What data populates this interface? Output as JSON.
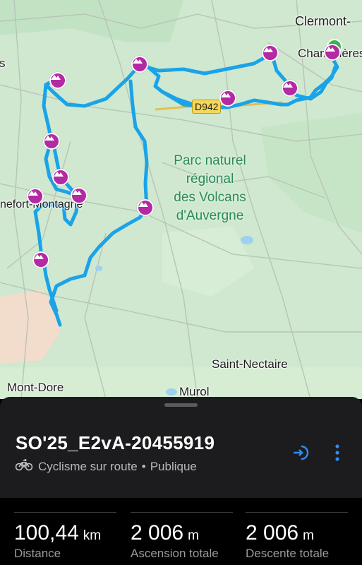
{
  "map": {
    "labels": {
      "clermont": "Clermont-",
      "chamalieres": "Chamalières",
      "left_edge": "s",
      "rocheford": "nefort-Montagne",
      "saint_nectaire": "Saint-Nectaire",
      "mont_dore": "Mont-Dore",
      "murol": "Murol"
    },
    "park": {
      "line1": "Parc naturel",
      "line2": "régional",
      "line3": "des Volcans",
      "line4": "d'Auvergne"
    },
    "road": "D942",
    "route_color": "#1aa3e8",
    "poi_color": "#b32aa3",
    "start_color": "#38b44a"
  },
  "sheet": {
    "title": "SO'25_E2vA-20455919",
    "activity": "Cyclisme sur route",
    "separator": "•",
    "visibility": "Publique",
    "accent": "#2f8cf0"
  },
  "stats": [
    {
      "value": "100,44",
      "unit": "km",
      "label": "Distance"
    },
    {
      "value": "2 006",
      "unit": "m",
      "label": "Ascension totale"
    },
    {
      "value": "2 006",
      "unit": "m",
      "label": "Descente totale"
    }
  ]
}
